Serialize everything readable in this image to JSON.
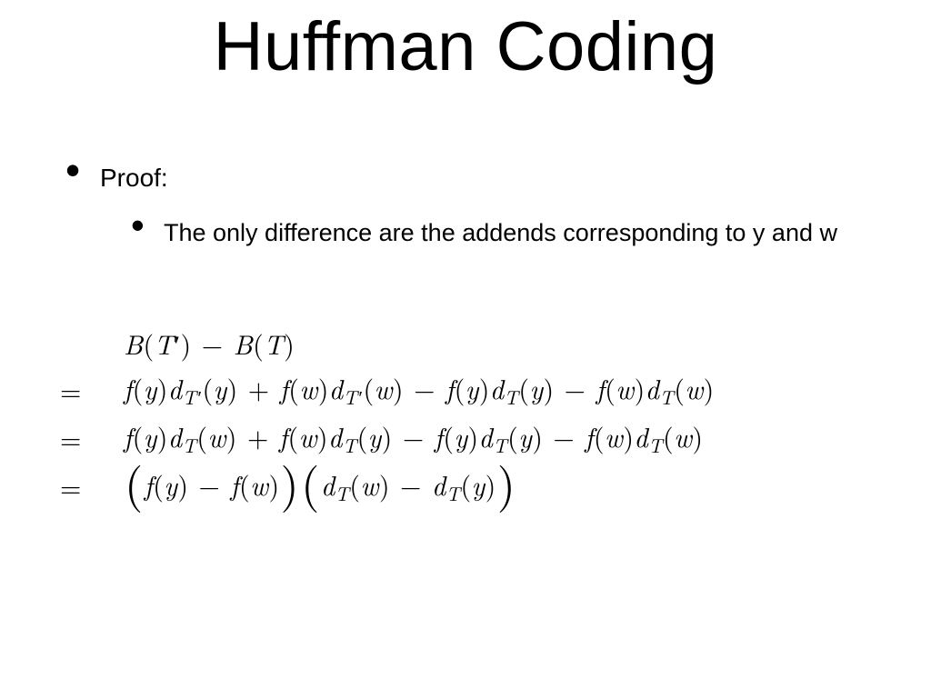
{
  "title": "Huffman Coding",
  "bullets": {
    "level1": "Proof:",
    "level2": "The only difference are the addends corresponding to y and w"
  },
  "math": {
    "line1_lhs": "",
    "line1": "B(T′) − B(T)",
    "line2_lhs": "=",
    "line2": "f(y)d_{T′}(y) + f(w)d_{T′}(w) − f(y)d_{T}(y) − f(w)d_{T}(w)",
    "line3_lhs": "=",
    "line3": "f(y)d_{T}(w) + f(w)d_{T}(y) − f(y)d_{T}(y) − f(w)d_{T}(w)",
    "line4_lhs": "=",
    "line4": "( f(y) − f(w) )( d_{T}(w) − d_{T}(y) )"
  }
}
